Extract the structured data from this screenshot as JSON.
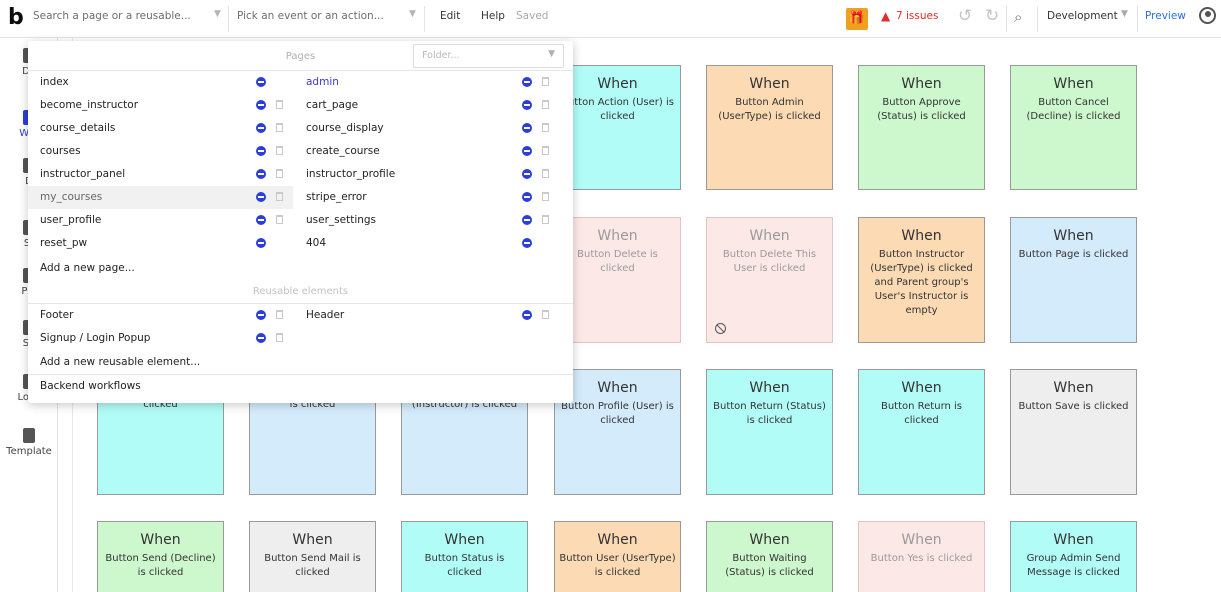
{
  "topbar": {
    "logo": "b",
    "search_placeholder": "Search a page or a reusable...",
    "event_placeholder": "Pick an event or an action...",
    "edit": "Edit",
    "help": "Help",
    "status": "Saved",
    "gift_icon": "gift-icon",
    "issues": "7 issues",
    "search_icon": "search-icon",
    "environment": "Development",
    "preview": "Preview"
  },
  "sidebar": {
    "items": [
      {
        "label": "De"
      },
      {
        "label": "Wor"
      },
      {
        "label": "D"
      },
      {
        "label": "St"
      },
      {
        "label": "Plu"
      },
      {
        "label": "Se"
      },
      {
        "label": "Logs"
      },
      {
        "label": "Template"
      }
    ]
  },
  "dropdown": {
    "pages_header": "Pages",
    "folder_placeholder": "Folder...",
    "pages_left": [
      "index",
      "become_instructor",
      "course_details",
      "courses",
      "instructor_panel",
      "my_courses",
      "user_profile",
      "reset_pw"
    ],
    "pages_right": [
      "admin",
      "cart_page",
      "course_display",
      "create_course",
      "instructor_profile",
      "stripe_error",
      "user_settings",
      "404"
    ],
    "add_page": "Add a new page...",
    "reusable_header": "Reusable elements",
    "reusables_left": [
      "Footer",
      "Signup / Login Popup"
    ],
    "reusables_right": [
      "Header"
    ],
    "add_reusable": "Add a new reusable element...",
    "backend": "Backend workflows"
  },
  "cards": [
    {
      "when": "When",
      "desc": "Button Action (User) is clicked",
      "color": "#b2fcf7"
    },
    {
      "when": "When",
      "desc": "Button Admin (UserType) is clicked",
      "color": "#fcdbb4"
    },
    {
      "when": "When",
      "desc": "Button Approve (Status) is clicked",
      "color": "#cdf7cd"
    },
    {
      "when": "When",
      "desc": "Button Cancel (Decline) is clicked",
      "color": "#cdf7cd"
    },
    {
      "when": "When",
      "desc": "Button Delete is clicked",
      "color": "#fde8e8"
    },
    {
      "when": "When",
      "desc": "Button Delete This User is clicked",
      "color": "#fde8e8"
    },
    {
      "when": "When",
      "desc": "Button Instructor (UserType) is clicked and Parent group's User's Instructor is empty",
      "color": "#fcdbb4"
    },
    {
      "when": "When",
      "desc": "Button Page is clicked",
      "color": "#d4ebfb"
    },
    {
      "when": "",
      "desc": "Button Preview is clicked",
      "color": "#b2fcf7"
    },
    {
      "when": "",
      "desc": "Button Profile (Admin) is clicked",
      "color": "#d4ebfb"
    },
    {
      "when": "",
      "desc": "Button Profile (Instructor) is clicked",
      "color": "#d4ebfb"
    },
    {
      "when": "When",
      "desc": "Button Profile (User) is clicked",
      "color": "#d4ebfb"
    },
    {
      "when": "When",
      "desc": "Button Return (Status) is clicked",
      "color": "#b2fcf7"
    },
    {
      "when": "When",
      "desc": "Button Return is clicked",
      "color": "#b2fcf7"
    },
    {
      "when": "When",
      "desc": "Button Save is clicked",
      "color": "#eeeeee"
    },
    {
      "when": "When",
      "desc": "Button Send (Decline) is clicked",
      "color": "#cdf7cd"
    },
    {
      "when": "When",
      "desc": "Button Send Mail is clicked",
      "color": "#eeeeee"
    },
    {
      "when": "When",
      "desc": "Button Status is clicked",
      "color": "#b2fcf7"
    },
    {
      "when": "When",
      "desc": "Button User (UserType) is clicked",
      "color": "#fcdbb4"
    },
    {
      "when": "When",
      "desc": "Button Waiting (Status) is clicked",
      "color": "#cdf7cd"
    },
    {
      "when": "When",
      "desc": "Button Yes is clicked",
      "color": "#fde8e8"
    },
    {
      "when": "When",
      "desc": "Group Admin Send Message is clicked",
      "color": "#b2fcf7"
    }
  ]
}
